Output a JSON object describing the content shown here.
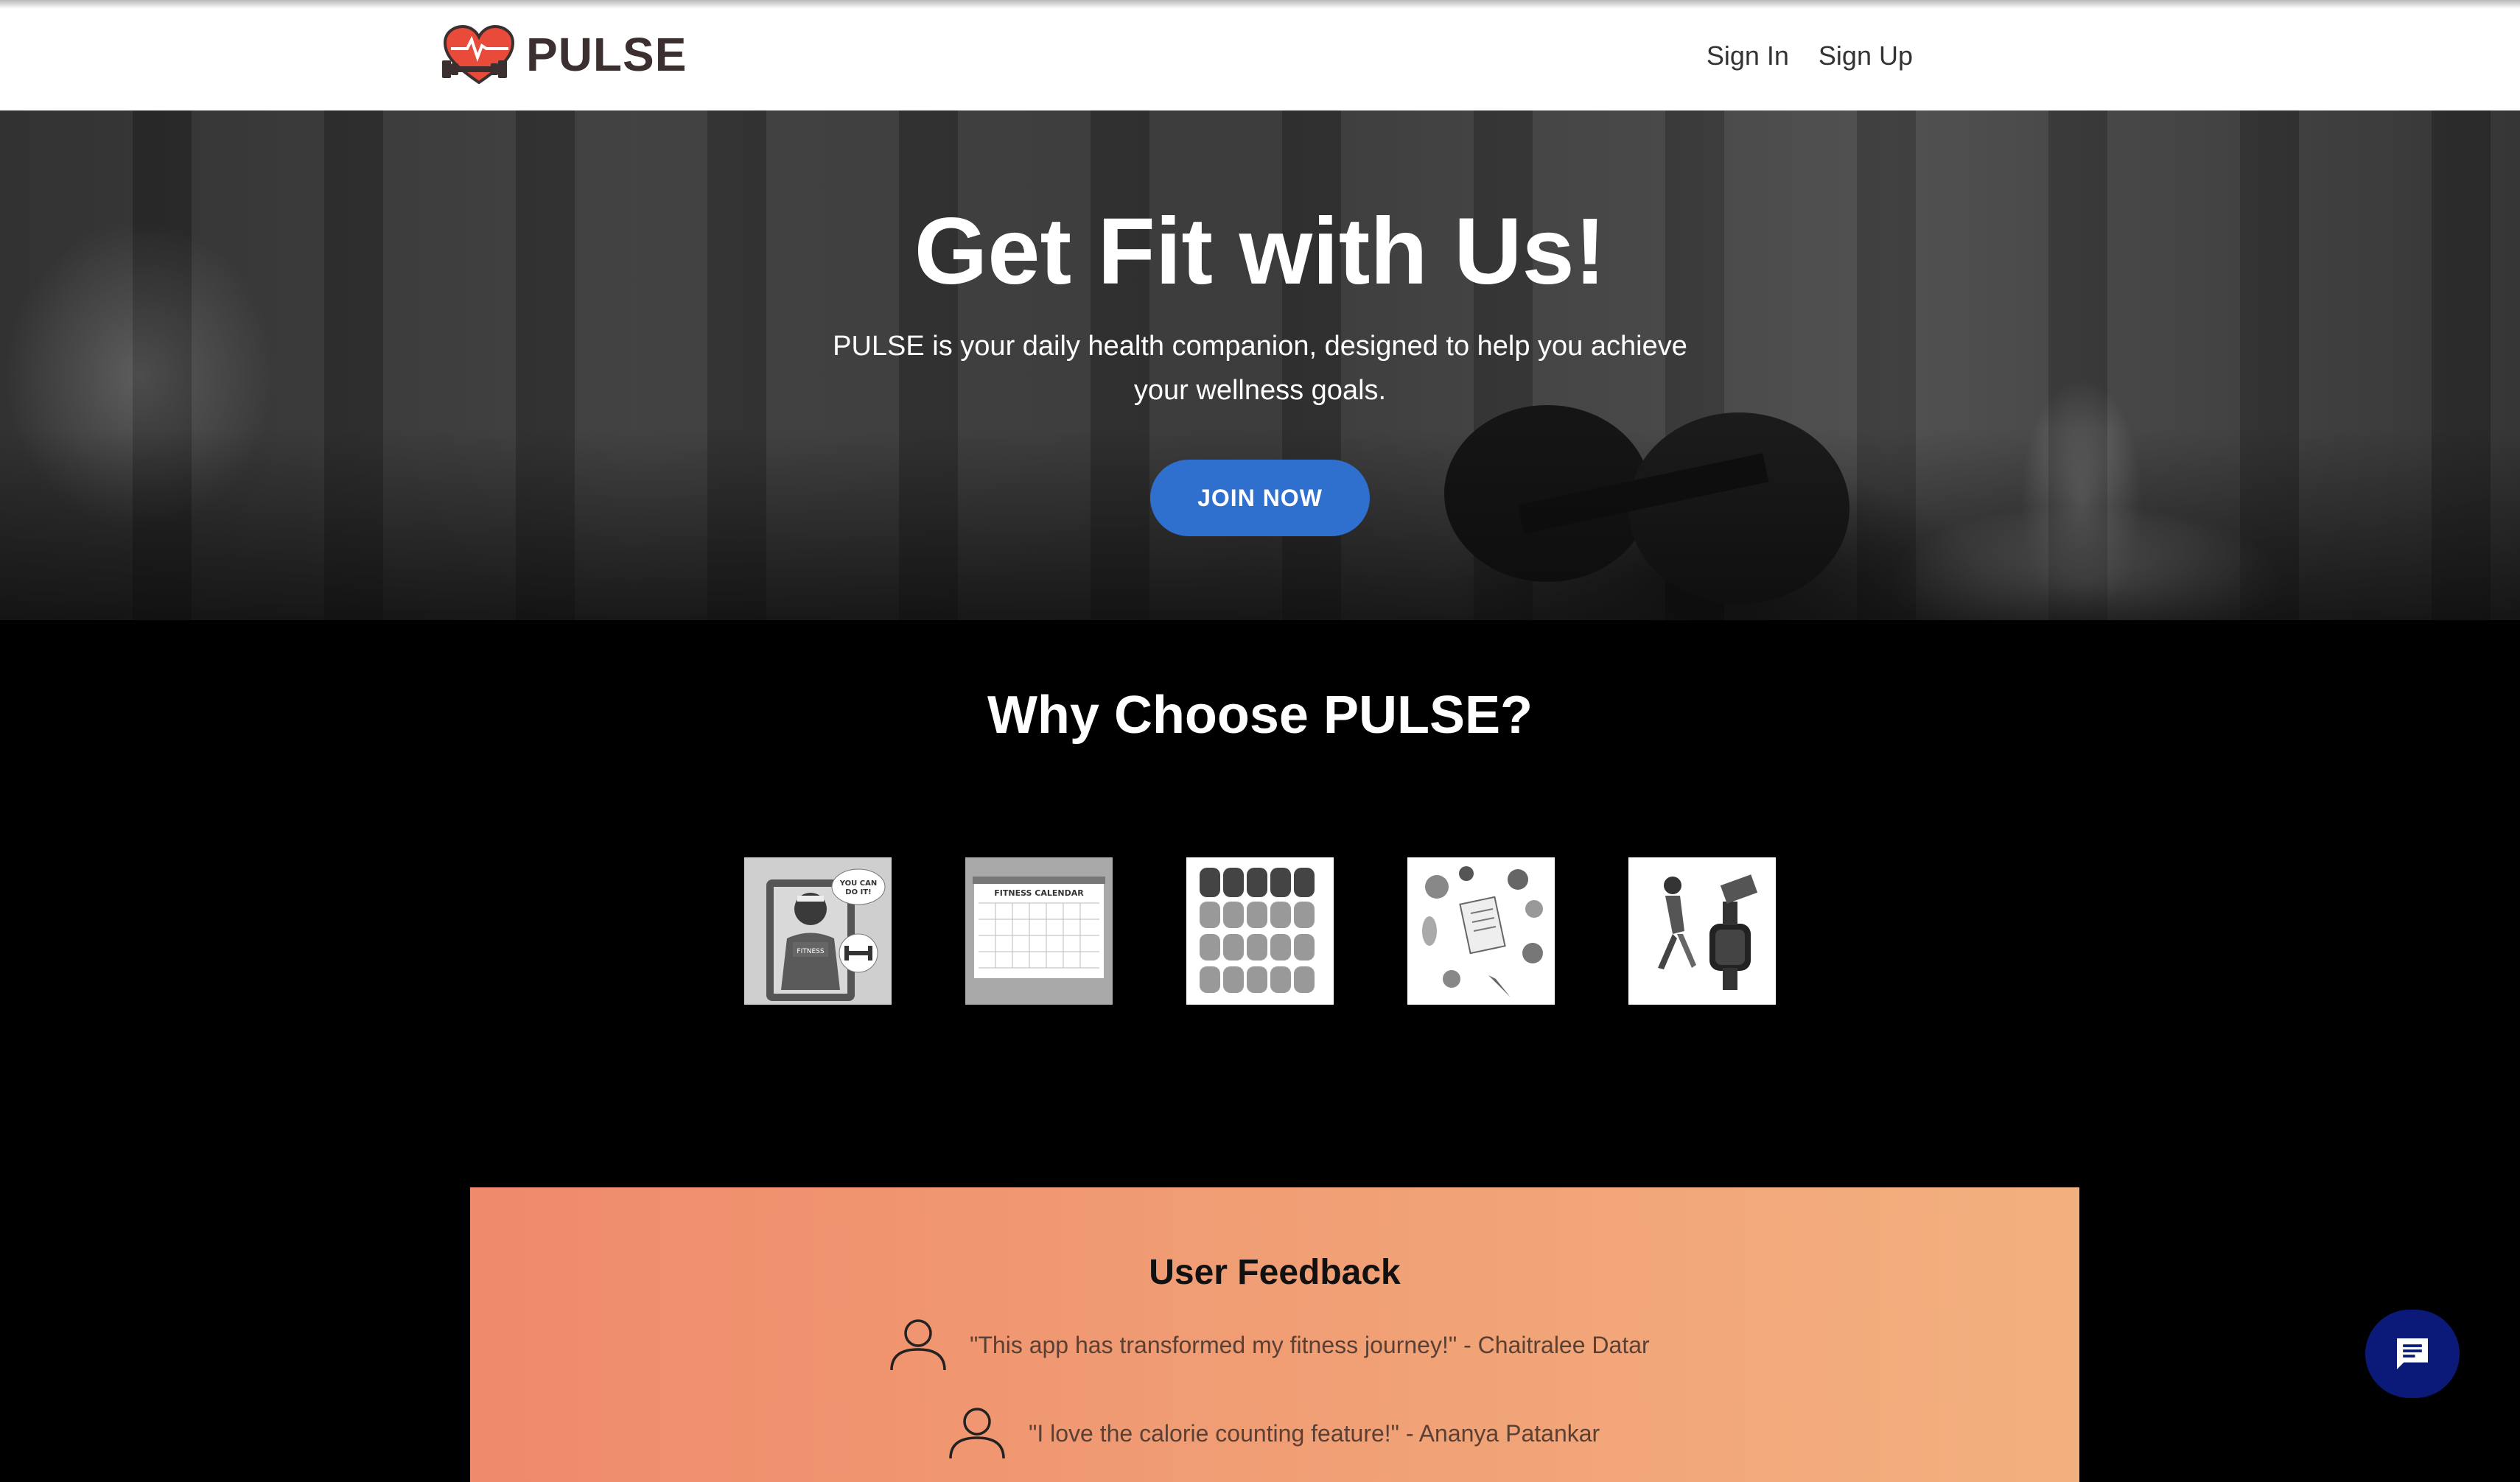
{
  "header": {
    "brand": "PULSE",
    "nav": {
      "sign_in": "Sign In",
      "sign_up": "Sign Up"
    }
  },
  "hero": {
    "title": "Get Fit with Us!",
    "subtitle": "PULSE is your daily health companion, designed to help you achieve your wellness goals.",
    "cta": "JOIN NOW"
  },
  "why": {
    "title": "Why Choose PULSE?",
    "features": [
      {
        "icon": "motivation-illustration",
        "text": "YOU CAN DO IT!",
        "badge": "FITNESS"
      },
      {
        "icon": "fitness-calendar-illustration",
        "text": "FITNESS CALENDAR"
      },
      {
        "icon": "nutrition-chart-illustration"
      },
      {
        "icon": "diet-plan-illustration"
      },
      {
        "icon": "smartwatch-tracking-illustration"
      }
    ]
  },
  "feedback": {
    "title": "User Feedback",
    "items": [
      {
        "text": "\"This app has transformed my fitness journey!\" - Chaitralee Datar"
      },
      {
        "text": "\"I love the calorie counting feature!\" - Ananya Patankar"
      }
    ]
  },
  "chat": {
    "icon": "chat-icon"
  },
  "colors": {
    "primary": "#2f6fce",
    "chat": "#0b1a78",
    "feedback_start": "#ef8a6b",
    "feedback_end": "#f3b07f",
    "logo": "#e84b3a"
  }
}
